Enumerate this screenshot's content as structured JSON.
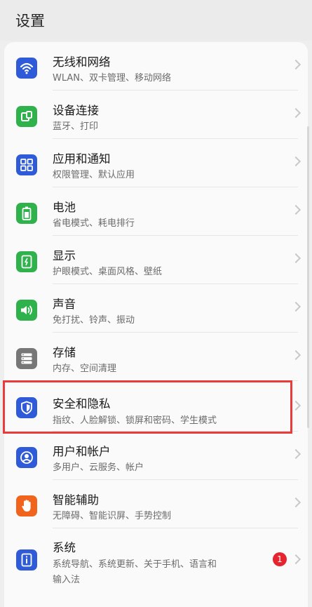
{
  "header": {
    "title": "设置"
  },
  "items": [
    {
      "label": "无线和网络",
      "sub": "WLAN、双卡管理、移动网络",
      "icon": "wifi-icon",
      "color": "#2f5bd8"
    },
    {
      "label": "设备连接",
      "sub": "蓝牙、打印",
      "icon": "device-connect-icon",
      "color": "#2fb24c"
    },
    {
      "label": "应用和通知",
      "sub": "权限管理、默认应用",
      "icon": "apps-grid-icon",
      "color": "#2f5bd8"
    },
    {
      "label": "电池",
      "sub": "省电模式、耗电排行",
      "icon": "battery-icon",
      "color": "#2fb24c"
    },
    {
      "label": "显示",
      "sub": "护眼模式、桌面风格、壁纸",
      "icon": "display-icon",
      "color": "#2fb24c"
    },
    {
      "label": "声音",
      "sub": "免打扰、铃声、振动",
      "icon": "speaker-icon",
      "color": "#2fb24c"
    },
    {
      "label": "存储",
      "sub": "内存、空间清理",
      "icon": "storage-icon",
      "color": "#777777"
    },
    {
      "label": "安全和隐私",
      "sub": "指纹、人脸解锁、锁屏和密码、学生模式",
      "icon": "shield-icon",
      "color": "#2f5bd8"
    },
    {
      "label": "用户和帐户",
      "sub": "多用户、云服务、帐户",
      "icon": "user-icon",
      "color": "#2f5bd8"
    },
    {
      "label": "智能辅助",
      "sub": "无障碍、智能识屏、手势控制",
      "icon": "hand-icon",
      "color": "#f0641e"
    },
    {
      "label": "系统",
      "sub": "系统导航、系统更新、关于手机、语言和",
      "sub2": "输入法",
      "icon": "info-icon",
      "color": "#2f5bd8",
      "badge": "1"
    }
  ]
}
